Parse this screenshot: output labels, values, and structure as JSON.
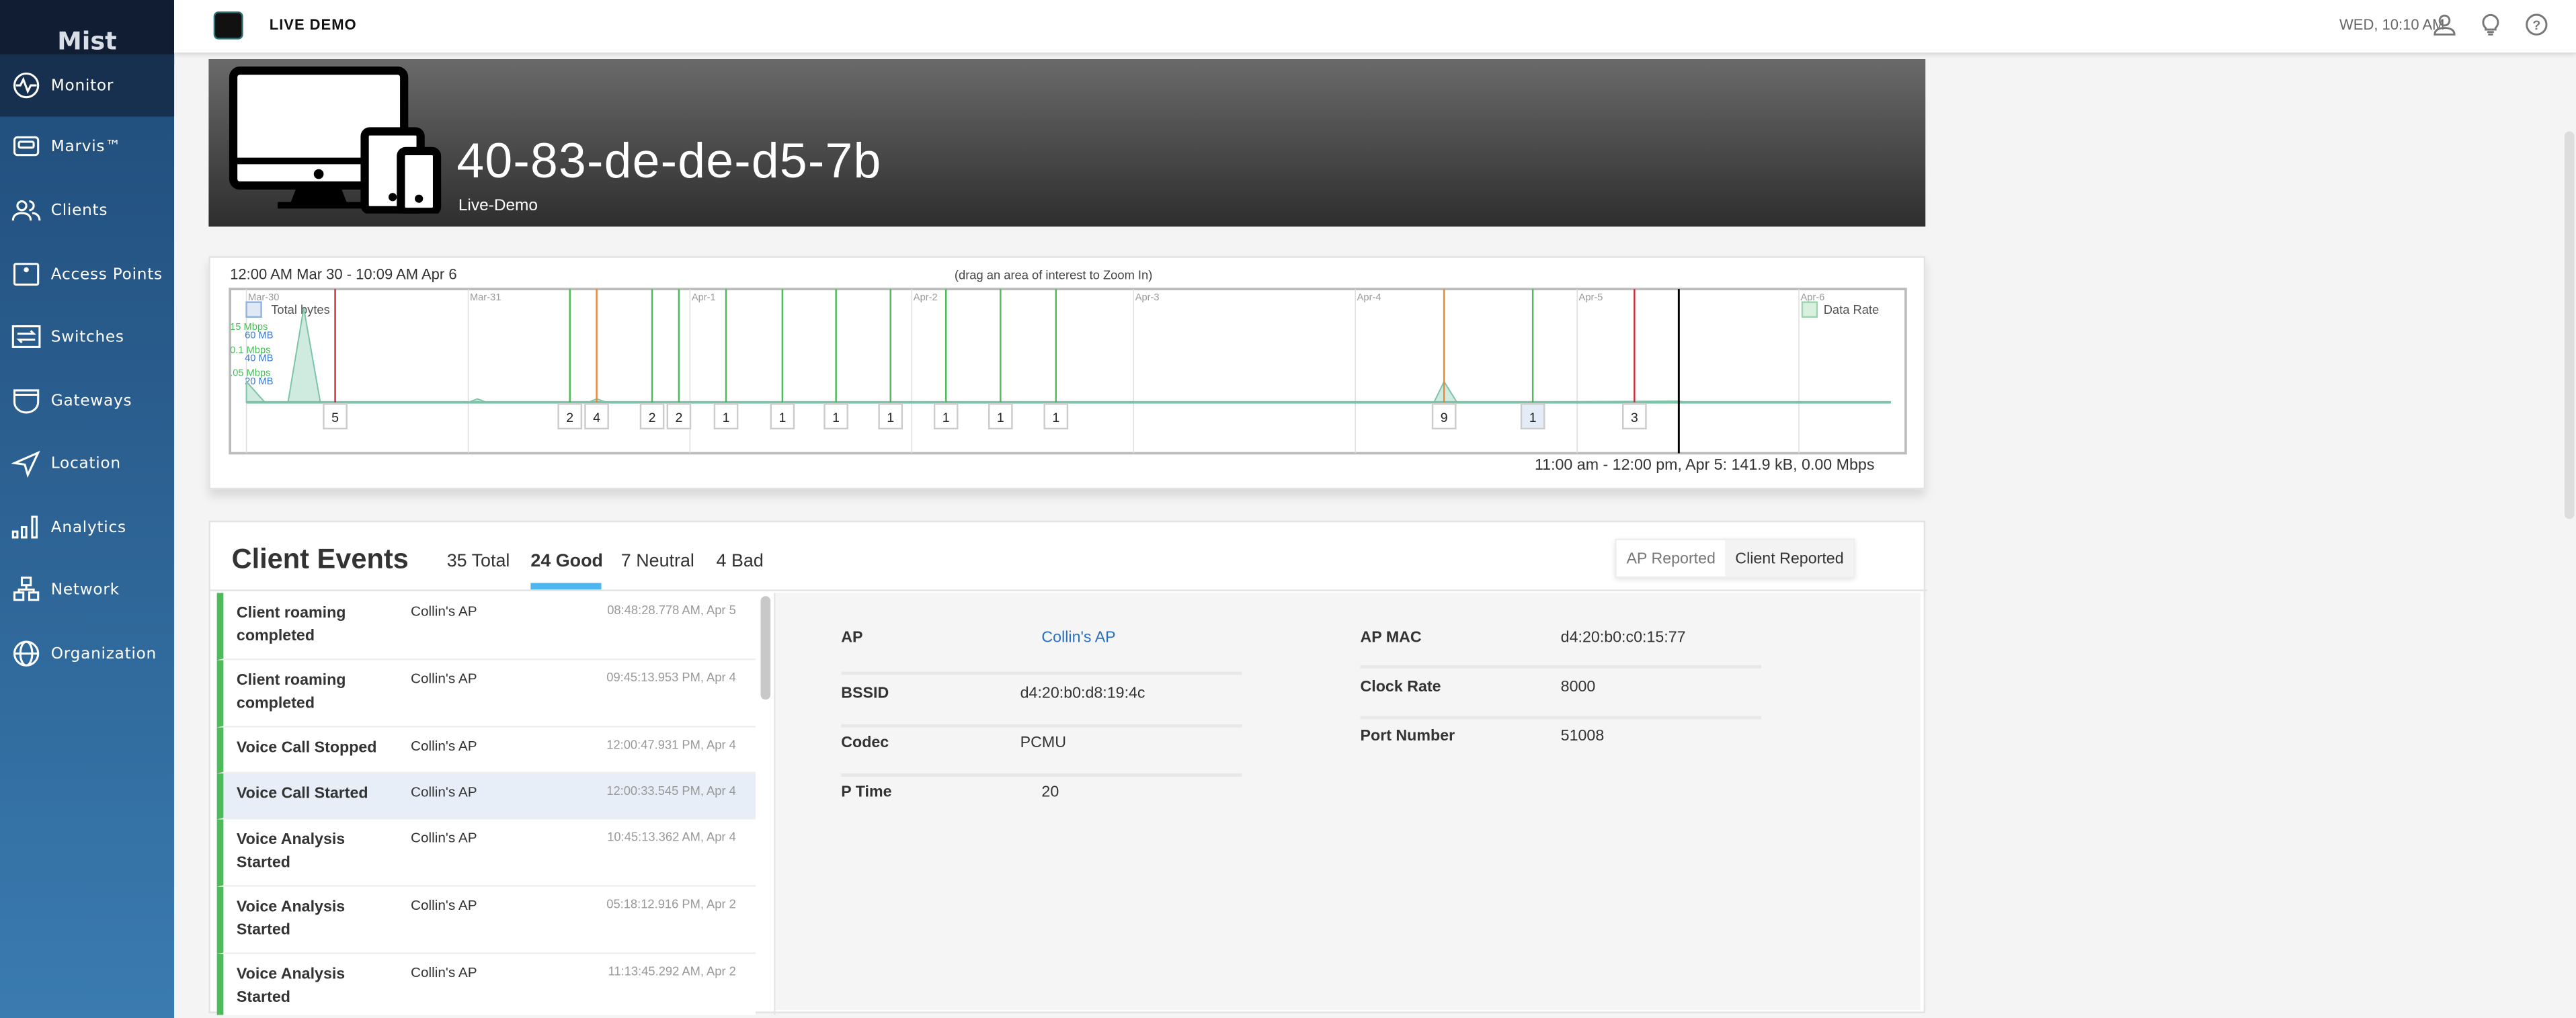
{
  "sidebar": {
    "logo": "Mist",
    "items": [
      {
        "label": "Monitor",
        "icon": "monitor-pulse-icon"
      },
      {
        "label": "Marvis™",
        "icon": "marvis-icon"
      },
      {
        "label": "Clients",
        "icon": "users-icon"
      },
      {
        "label": "Access Points",
        "icon": "access-point-icon"
      },
      {
        "label": "Switches",
        "icon": "switch-icon"
      },
      {
        "label": "Gateways",
        "icon": "gateway-icon"
      },
      {
        "label": "Location",
        "icon": "location-arrow-icon"
      },
      {
        "label": "Analytics",
        "icon": "bar-chart-icon"
      },
      {
        "label": "Network",
        "icon": "network-icon"
      },
      {
        "label": "Organization",
        "icon": "globe-icon"
      }
    ],
    "active": "Monitor"
  },
  "topbar": {
    "org": "LIVE DEMO",
    "clock": "WED, 10:10 AM"
  },
  "client": {
    "mac": "40-83-de-de-d5-7b",
    "site": "Live-Demo"
  },
  "chart_data": {
    "type": "area",
    "title": "12:00 AM Mar 30 - 10:09 AM Apr 6",
    "hint": "(drag an area of interest to Zoom In)",
    "readout": "11:00 am - 12:00 pm, Apr 5: 141.9 kB, 0.00 Mbps",
    "x_unit": "hours since 12:00 AM Mar 30",
    "xlim": [
      0,
      179.7
    ],
    "day_labels": [
      "Mar-30",
      "Mar-31",
      "Apr-1",
      "Apr-2",
      "Apr-3",
      "Apr-4",
      "Apr-5",
      "Apr-6"
    ],
    "legend": [
      "Total bytes",
      "Data Rate"
    ],
    "y_ticks_rate": [
      "15 Mbps",
      "0.1 Mbps",
      ".05 Mbps"
    ],
    "y_ticks_bytes": [
      "60 MB",
      "40 MB",
      "20 MB"
    ],
    "ylim_mb": [
      0,
      90
    ],
    "series": [
      {
        "name": "Data Rate",
        "points": [
          [
            0,
            18
          ],
          [
            2,
            0
          ],
          [
            4.5,
            0
          ],
          [
            6.2,
            82
          ],
          [
            8,
            0
          ],
          [
            24,
            0
          ],
          [
            25,
            3
          ],
          [
            26,
            0
          ],
          [
            37,
            0
          ],
          [
            37.9,
            3
          ],
          [
            39,
            0
          ],
          [
            128.5,
            0
          ],
          [
            129.6,
            18
          ],
          [
            131,
            0
          ],
          [
            155,
            1
          ],
          [
            156,
            0
          ]
        ]
      }
    ],
    "events": [
      {
        "hour": 9.6,
        "count": 5,
        "kind": "bad"
      },
      {
        "hour": 35.0,
        "count": 2,
        "kind": "good"
      },
      {
        "hour": 37.9,
        "count": 4,
        "kind": "neutral"
      },
      {
        "hour": 43.9,
        "count": 2,
        "kind": "good"
      },
      {
        "hour": 46.8,
        "count": 2,
        "kind": "good"
      },
      {
        "hour": 51.9,
        "count": 1,
        "kind": "good"
      },
      {
        "hour": 58.0,
        "count": 1,
        "kind": "good"
      },
      {
        "hour": 63.8,
        "count": 1,
        "kind": "good"
      },
      {
        "hour": 69.7,
        "count": 1,
        "kind": "good"
      },
      {
        "hour": 75.7,
        "count": 1,
        "kind": "good"
      },
      {
        "hour": 81.6,
        "count": 1,
        "kind": "good"
      },
      {
        "hour": 87.6,
        "count": 1,
        "kind": "good"
      },
      {
        "hour": 129.6,
        "count": 9,
        "kind": "neutral"
      },
      {
        "hour": 139.2,
        "count": 1,
        "kind": "good",
        "selected": true
      },
      {
        "hour": 150.2,
        "count": 3,
        "kind": "bad"
      }
    ],
    "cursor_hour": 155,
    "colors": {
      "good": "#4cbb5a",
      "neutral": "#e8883a",
      "bad": "#c8303a",
      "area": "#7bc4a8",
      "rate_tick": "#4cbb5a",
      "bytes_tick": "#3b78c8"
    }
  },
  "events": {
    "title": "Client Events",
    "filters": {
      "total": "35 Total",
      "good": "24 Good",
      "neutral": "7 Neutral",
      "bad": "4 Bad"
    },
    "source": {
      "ap": "AP Reported",
      "client": "Client Reported"
    },
    "rows": [
      {
        "name": "Client roaming completed",
        "ap": "Collin's AP",
        "time": "08:48:28.778 AM, Apr 5"
      },
      {
        "name": "Client roaming completed",
        "ap": "Collin's AP",
        "time": "09:45:13.953 PM, Apr 4"
      },
      {
        "name": "Voice Call Stopped",
        "ap": "Collin's AP",
        "time": "12:00:47.931 PM, Apr 4"
      },
      {
        "name": "Voice Call Started",
        "ap": "Collin's AP",
        "time": "12:00:33.545 PM, Apr 4"
      },
      {
        "name": "Voice Analysis Started",
        "ap": "Collin's AP",
        "time": "10:45:13.362 AM, Apr 4"
      },
      {
        "name": "Voice Analysis Started",
        "ap": "Collin's AP",
        "time": "05:18:12.916 PM, Apr 2"
      },
      {
        "name": "Voice Analysis Started",
        "ap": "Collin's AP",
        "time": "11:13:45.292 AM, Apr 2"
      }
    ],
    "detail": {
      "left": [
        {
          "label": "AP",
          "value": "Collin's AP"
        },
        {
          "label": "BSSID",
          "value": "d4:20:b0:d8:19:4c"
        },
        {
          "label": "Codec",
          "value": "PCMU"
        },
        {
          "label": "P Time",
          "value": "20"
        }
      ],
      "right": [
        {
          "label": "AP MAC",
          "value": "d4:20:b0:c0:15:77"
        },
        {
          "label": "Clock Rate",
          "value": "8000"
        },
        {
          "label": "Port Number",
          "value": "51008"
        }
      ]
    }
  }
}
